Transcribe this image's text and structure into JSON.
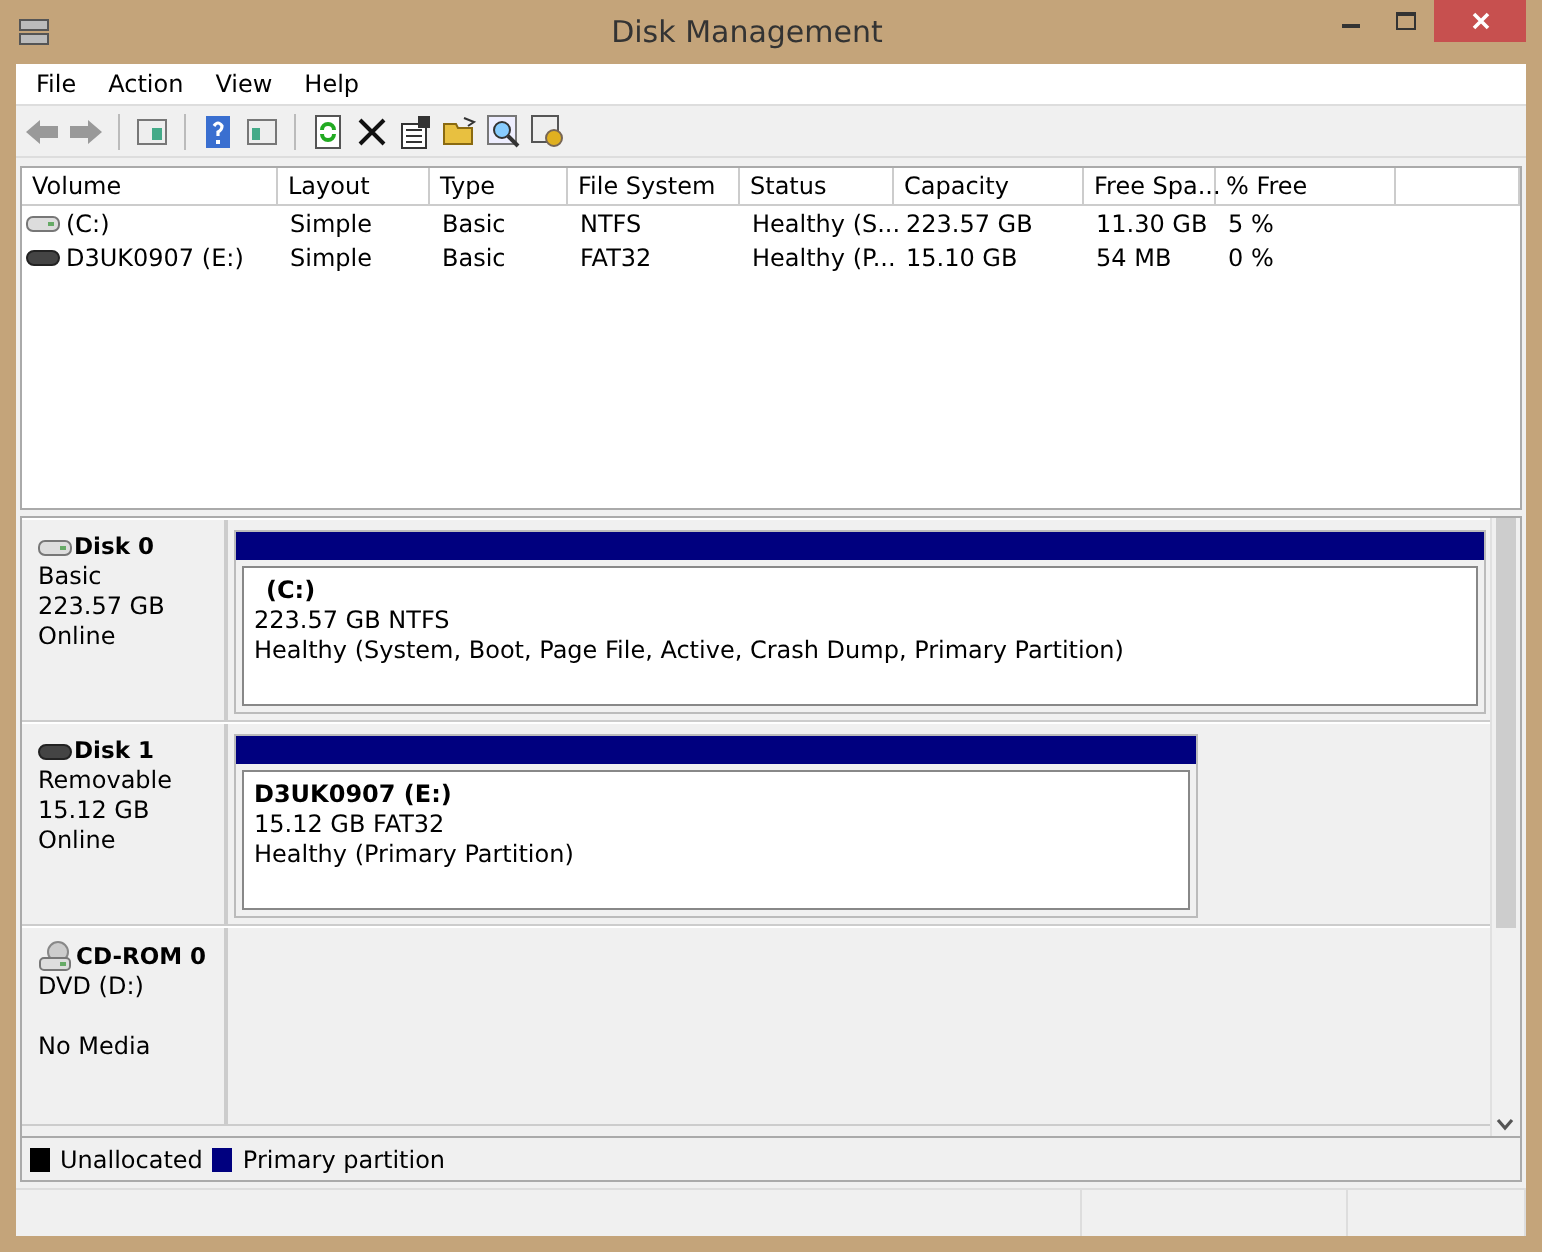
{
  "window": {
    "title": "Disk Management"
  },
  "menu": [
    "File",
    "Action",
    "View",
    "Help"
  ],
  "volume_table": {
    "columns": [
      "Volume",
      "Layout",
      "Type",
      "File System",
      "Status",
      "Capacity",
      "Free Spa...",
      "% Free"
    ],
    "rows": [
      {
        "kind": "hdd",
        "cells": [
          "(C:)",
          "Simple",
          "Basic",
          "NTFS",
          "Healthy (S...",
          "223.57 GB",
          "11.30 GB",
          "5 %"
        ]
      },
      {
        "kind": "removable",
        "cells": [
          "D3UK0907 (E:)",
          "Simple",
          "Basic",
          "FAT32",
          "Healthy (P...",
          "15.10 GB",
          "54 MB",
          "0 %"
        ]
      }
    ]
  },
  "disks": [
    {
      "kind": "hdd",
      "name": "Disk 0",
      "lines": [
        "Basic",
        "223.57 GB",
        "Online"
      ],
      "partitions": [
        {
          "label": "(C:)",
          "size": "223.57 GB NTFS",
          "status": "Healthy (System, Boot, Page File, Active, Crash Dump, Primary Partition)"
        }
      ]
    },
    {
      "kind": "removable",
      "name": "Disk 1",
      "lines": [
        "Removable",
        "15.12 GB",
        "Online"
      ],
      "partitions": [
        {
          "label": "D3UK0907  (E:)",
          "size": "15.12 GB FAT32",
          "status": "Healthy (Primary Partition)"
        }
      ]
    },
    {
      "kind": "cdrom",
      "name": "CD-ROM 0",
      "lines": [
        "DVD (D:)",
        "No Media"
      ]
    }
  ],
  "legend": [
    {
      "label": "Unallocated",
      "color": "#000000"
    },
    {
      "label": "Primary partition",
      "color": "#00007f"
    }
  ]
}
